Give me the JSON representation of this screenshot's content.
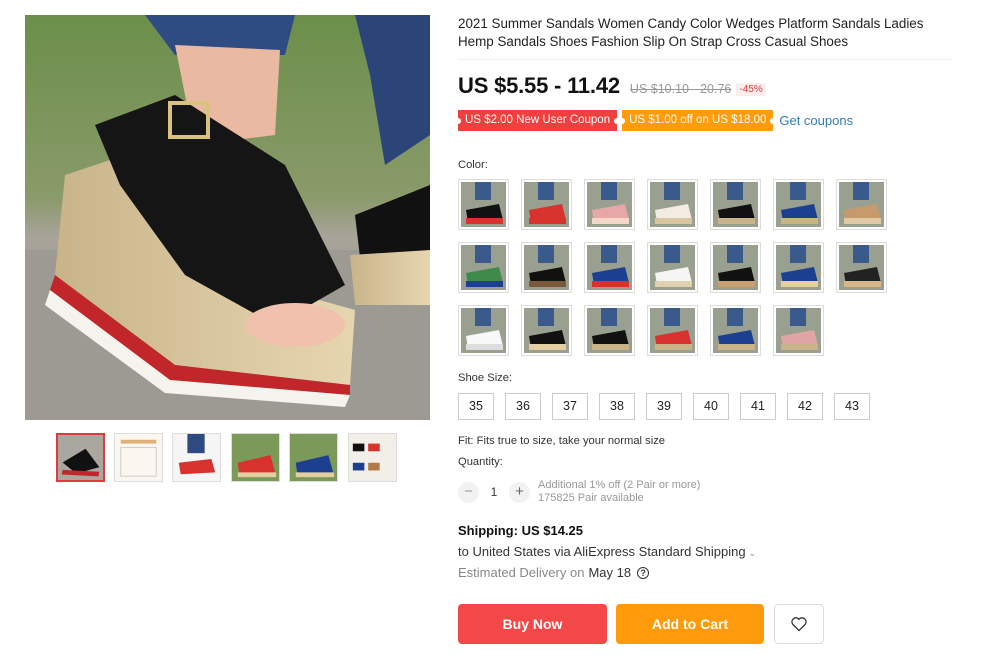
{
  "product": {
    "title": "2021 Summer Sandals Women Candy Color Wedges Platform Sandals Ladies Hemp Sandals Shoes Fashion Slip On Strap Cross Casual Shoes",
    "price": "US $5.55 - 11.42",
    "original_price": "US $10.10 - 20.76",
    "discount": "-45%"
  },
  "coupons": {
    "new_user": "US $2.00 New User Coupon",
    "off": "US $1.00 off on US $18.00",
    "get_label": "Get coupons"
  },
  "color": {
    "label": "Color:",
    "swatches": [
      "red-black",
      "red",
      "pink",
      "white-beige",
      "black-thong",
      "navy-thong",
      "tan",
      "green",
      "brown-black",
      "blue-red",
      "white",
      "black-tan",
      "navy-beige",
      "black-tan-2",
      "white-sneaker",
      "black-slipper",
      "black-wedge",
      "red-wedge",
      "navy-wedge",
      "pink-wedge"
    ]
  },
  "size": {
    "label": "Shoe Size:",
    "options": [
      "35",
      "36",
      "37",
      "38",
      "39",
      "40",
      "41",
      "42",
      "43"
    ]
  },
  "fit": "Fit: Fits true to size, take your normal size",
  "quantity": {
    "label": "Quantity:",
    "minus": "−",
    "value": "1",
    "plus": "+",
    "offer": "Additional 1% off (2 Pair or more)",
    "available": "175825 Pair available"
  },
  "shipping": {
    "label": "Shipping:",
    "price": "US $14.25",
    "method": "to United States via AliExpress Standard Shipping",
    "chevron": "⌄",
    "estimate_label": "Estimated Delivery on",
    "estimate_date": "May 18",
    "help_icon": "?"
  },
  "actions": {
    "buy_now": "Buy Now",
    "add_to_cart": "Add to Cart",
    "wishlist_icon": "heart-icon"
  },
  "colors": {
    "buy": "#f44848",
    "cart": "#ff9a0a",
    "coupon_red": "#f03f3f",
    "coupon_orange": "#ff9c0d",
    "link": "#2e7fb8"
  }
}
